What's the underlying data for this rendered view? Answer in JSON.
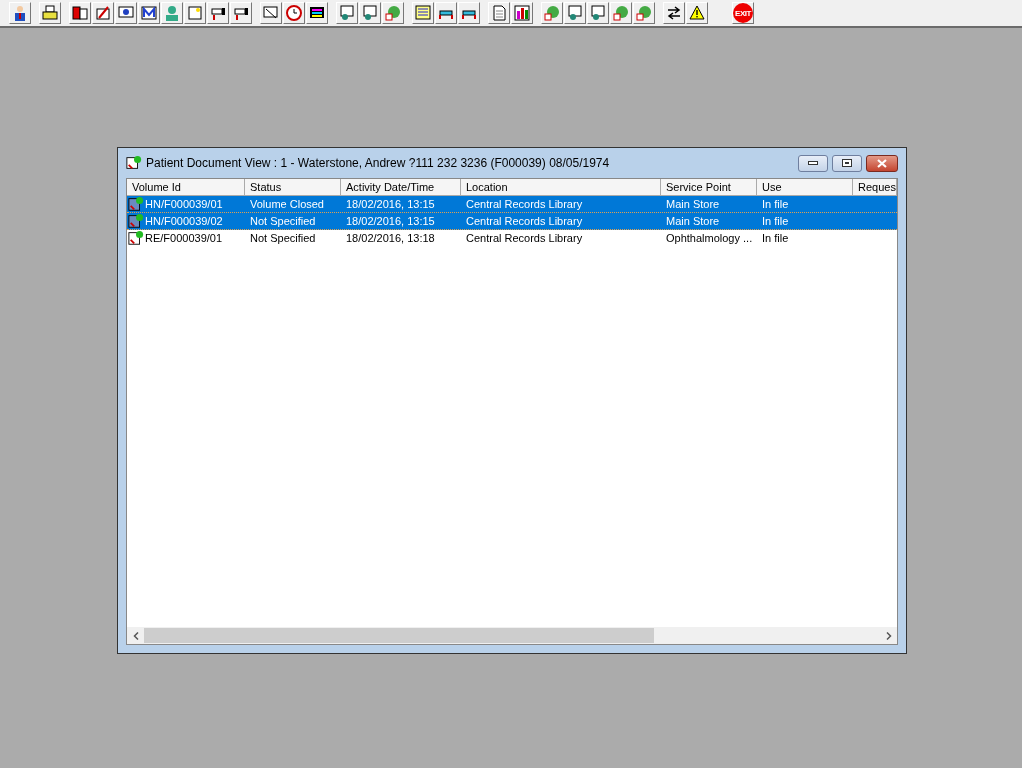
{
  "toolbar": {
    "exit_label": "EXIT"
  },
  "window": {
    "title": "Patient Document View : 1 - Waterstone, Andrew ?111 232 3236 (F000039) 08/05/1974"
  },
  "table": {
    "columns": [
      "Volume Id",
      "Status",
      "Activity Date/Time",
      "Location",
      "Service Point",
      "Use",
      "Reques"
    ],
    "rows": [
      {
        "selected": true,
        "cells": [
          "HN/F000039/01",
          "Volume Closed",
          "18/02/2016, 13:15",
          "Central Records Library",
          "Main Store",
          "In file"
        ]
      },
      {
        "selected": true,
        "cells": [
          "HN/F000039/02",
          "Not Specified",
          "18/02/2016, 13:15",
          "Central Records Library",
          "Main Store",
          "In file"
        ]
      },
      {
        "selected": false,
        "cells": [
          "RE/F000039/01",
          "Not Specified",
          "18/02/2016, 13:18",
          "Central Records Library",
          "Ophthalmology ...",
          "In file"
        ]
      }
    ]
  }
}
